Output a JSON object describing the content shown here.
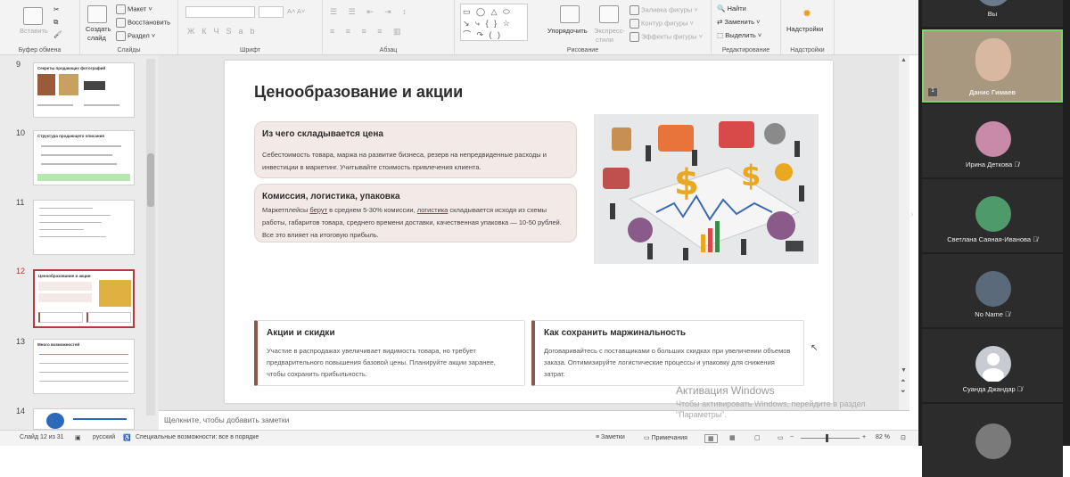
{
  "ribbon": {
    "clipboard": {
      "paste": "Вставить",
      "group": "Буфер обмена"
    },
    "slides": {
      "create": "Создать",
      "create2": "слайд",
      "layout": "Макет",
      "reset": "Восстановить",
      "section": "Раздел",
      "group": "Слайды"
    },
    "font": {
      "group": "Шрифт"
    },
    "paragraph": {
      "group": "Абзац"
    },
    "drawing": {
      "arrange": "Упорядочить",
      "quickstyles": "Экспресс-",
      "quickstyles2": "стили",
      "fill": "Заливка фигуры",
      "outline": "Контур фигуры",
      "effects": "Эффекты фигуры",
      "group": "Рисование"
    },
    "editing": {
      "find": "Найти",
      "replace": "Заменить",
      "select": "Выделить",
      "group": "Редактирование"
    },
    "addins": {
      "label": "Надстройки",
      "group": "Надстройки"
    }
  },
  "thumbnails": [
    {
      "num": "9",
      "title": "Секреты продающих фотографий"
    },
    {
      "num": "10",
      "title": "Структура продающего описания"
    },
    {
      "num": "11",
      "title": ""
    },
    {
      "num": "12",
      "title": "Ценообразование и акции"
    },
    {
      "num": "13",
      "title": "Много возможностей"
    },
    {
      "num": "14",
      "title": ""
    }
  ],
  "slide": {
    "title": "Ценообразование и акции",
    "card1": {
      "heading": "Из чего складывается цена",
      "text": "Себестоимость товара, маржа на развитие бизнеса, резерв на непредвиденные расходы и инвестиции в маркетинг. Учитывайте стоимость привлечения клиента."
    },
    "card2": {
      "heading": "Комиссия, логистика, упаковка",
      "t1": "Маркетплейсы ",
      "t2": "берут",
      "t3": " в среднем 5-30% комиссии, ",
      "t4": "логистика",
      "t5": " складывается исходя из схемы работы, габаритов товара, среднего времени доставки, качественная упаковка — 10-50 рублей. Все это влияет на итоговую прибыль."
    },
    "card3": {
      "heading": "Акции и скидки",
      "text": "Участие в распродажах увеличивает видимость товара, но требует предварительного повышения базовой цены. Планируйте акции заранее, чтобы сохранить прибыльность."
    },
    "card4": {
      "heading": "Как сохранить маржинальность",
      "text": "Договаривайтесь с поставщиками о больших скидках при увеличении объемов заказа. Оптимизируйте логистические процессы и упаковку для снижения затрат."
    }
  },
  "notes_placeholder": "Щелкните, чтобы добавить заметки",
  "watermark": {
    "line1": "Активация Windows",
    "line2": "Чтобы активировать Windows, перейдите в раздел \"Параметры\"."
  },
  "status": {
    "slide": "Слайд 12 из 31",
    "lang": "русский",
    "access": "Специальные возможности: все в порядке",
    "notes": "Заметки",
    "comments": "Примечания",
    "zoom": "82 %"
  },
  "participants": [
    {
      "name": "Вы",
      "color": "#6b7b8c"
    },
    {
      "name": "Данис Гимаев",
      "color": "#8a7a6a"
    },
    {
      "name": "Ирина Деткова",
      "color": "#c98aa8"
    },
    {
      "name": "Светлана Саяная-Иванова",
      "color": "#4e9a6a"
    },
    {
      "name": "No Name",
      "color": "#5a6a7a"
    },
    {
      "name": "Суанда Джандар",
      "color": "#9aa0a8"
    }
  ]
}
